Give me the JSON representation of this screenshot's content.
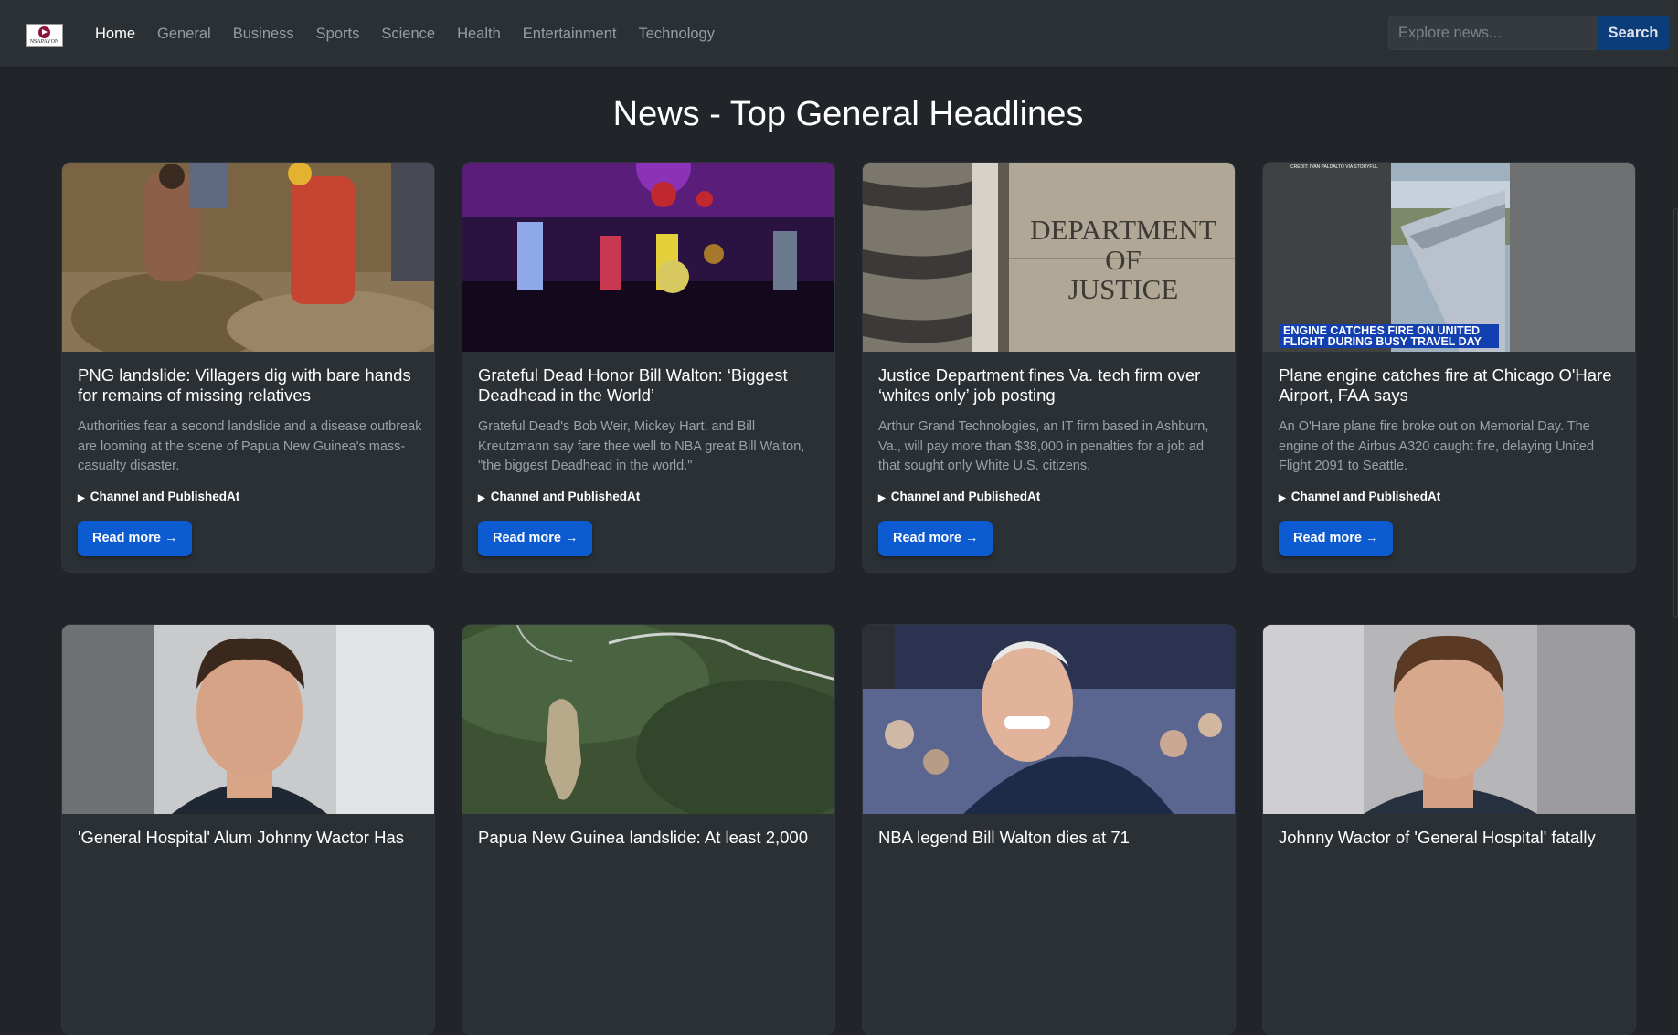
{
  "nav": {
    "logo_text": "NSAPAYON",
    "links": [
      "Home",
      "General",
      "Business",
      "Sports",
      "Science",
      "Health",
      "Entertainment",
      "Technology"
    ],
    "active_link": "Home",
    "search_placeholder": "Explore news...",
    "search_button": "Search"
  },
  "page": {
    "title": "News - Top General Headlines"
  },
  "cards_row1": [
    {
      "title": "PNG landslide: Villagers dig with bare hands for remains of missing relatives",
      "description": "Authorities fear a second landslide and a disease outbreak are looming at the scene of Papua New Guinea's mass-casualty disaster.",
      "meta_label": "Channel and PublishedAt",
      "button": "Read more →",
      "image": "landslide-rescue-photo"
    },
    {
      "title": "Grateful Dead Honor Bill Walton: ‘Biggest Deadhead in the World’",
      "description": "Grateful Dead's Bob Weir, Mickey Hart, and Bill Kreutzmann say fare thee well to NBA great Bill Walton, \"the biggest Deadhead in the world.\"",
      "meta_label": "Channel and PublishedAt",
      "button": "Read more →",
      "image": "concert-stage-photo"
    },
    {
      "title": "Justice Department fines Va. tech firm over ‘whites only’ job posting",
      "description": "Arthur Grand Technologies, an IT firm based in Ashburn, Va., will pay more than $38,000 in penalties for a job ad that sought only White U.S. citizens.",
      "meta_label": "Channel and PublishedAt",
      "button": "Read more →",
      "image": "department-of-justice-sign",
      "image_text": [
        "DEPARTMENT",
        "OF",
        "JUSTICE"
      ]
    },
    {
      "title": "Plane engine catches fire at Chicago O'Hare Airport, FAA says",
      "description": "An O'Hare plane fire broke out on Memorial Day. The engine of the Airbus A320 caught fire, delaying United Flight 2091 to Seattle.",
      "meta_label": "Channel and PublishedAt",
      "button": "Read more →",
      "image": "plane-wing-video-still",
      "image_credit": "CREDIT: IVAN PALDALTO VIA STORYFUL",
      "image_caption": [
        "ENGINE CATCHES FIRE ON UNITED",
        "FLIGHT DURING BUSY TRAVEL DAY"
      ]
    }
  ],
  "cards_row2": [
    {
      "title": "'General Hospital' Alum Johnny Wactor Has",
      "image": "man-portrait-photo"
    },
    {
      "title": "Papua New Guinea landslide: At least 2,000",
      "image": "aerial-landslide-photo"
    },
    {
      "title": "NBA legend Bill Walton dies at 71",
      "image": "smiling-man-arena-photo"
    },
    {
      "title": "Johnny Wactor of 'General Hospital' fatally",
      "image": "man-portrait-photo-2"
    }
  ],
  "colors": {
    "background": "#212529",
    "navbar": "#2b3035",
    "card": "#2b3035",
    "button": "#0d5bd0",
    "search_button": "#0b3d7a"
  }
}
